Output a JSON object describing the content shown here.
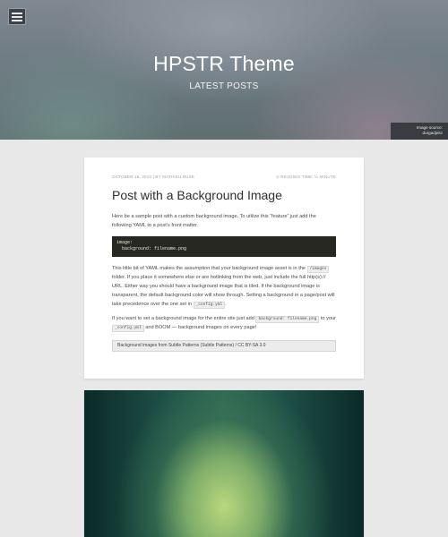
{
  "header": {
    "site_title": "HPSTR Theme",
    "subtitle": "LATEST POSTS",
    "image_credit_line1": "Image source:",
    "image_credit_line2": "durgadjeitz",
    "menu_icon": "hamburger-menu-icon"
  },
  "post": {
    "meta_date": "OCTOBER 16, 2013 | BY MATHIEU BUSE",
    "meta_read_time": "⊙ READING TIME: ½ MINUTE",
    "title": "Post with a Background Image",
    "p1": "Here be a sample post with a custom background image. To utilize this “feature” just add the following YAML to a post’s front matter.",
    "code_line1": "image:",
    "code_line2": "  background: filename.png",
    "p2_a": "This little bit of YAML makes the assumption that your background image asset is in the",
    "p2_code1": "/images",
    "p2_b": "folder. If you place it somewhere else or are hotlinking from the web, just include the full http(s):// URL. Either way you should have a background image that is tiled. If the background image is transparent, the default background color will show through. Setting a background in a page/post will take precedence over the one set in",
    "p2_code2": "_config.yml",
    "p2_c": ".",
    "p3_a": "If you want to set a background image for the entire site just add",
    "p3_code1": "background: filename.png",
    "p3_b": "to your",
    "p3_code2": "_config.yml",
    "p3_c": "and BOOM — background images on every page!",
    "note": "Background images from Subtle Patterns (Subtle Patterns) / CC BY-SA 3.0"
  },
  "colors": {
    "page_bg": "#e8e8e8",
    "card_bg": "#ffffff",
    "code_bg": "#272822"
  }
}
